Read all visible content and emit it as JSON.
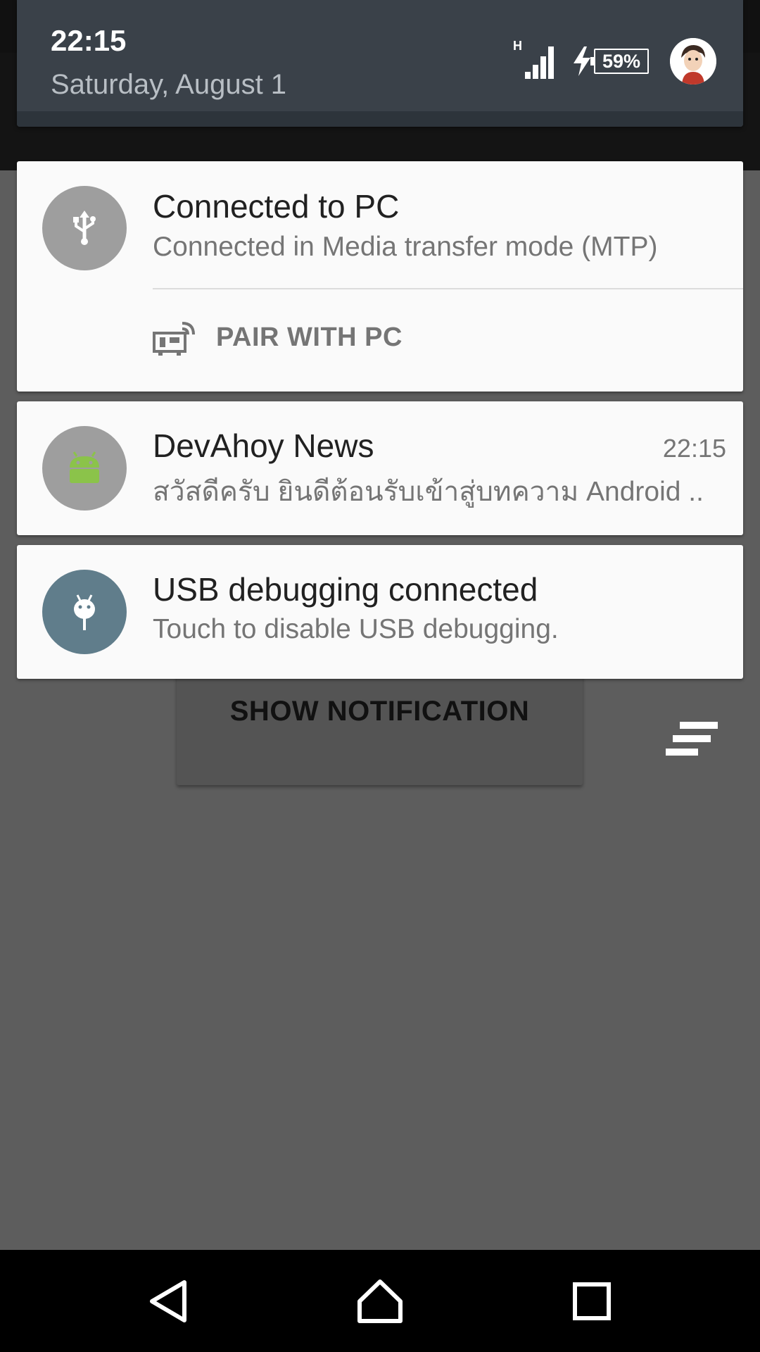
{
  "status_bar": {
    "time": "22:15",
    "date": "Saturday, August 1",
    "network_type": "H",
    "battery_percent": "59%",
    "icons": [
      "signal-icon",
      "charging-icon",
      "battery-icon",
      "user-avatar"
    ]
  },
  "notifications": [
    {
      "icon": "usb-icon",
      "icon_bg": "#9e9e9e",
      "title": "Connected to PC",
      "text": "Connected in Media transfer mode (MTP)",
      "action": {
        "icon": "pair-with-pc-icon",
        "label": "PAIR WITH PC"
      }
    },
    {
      "icon": "android-icon",
      "icon_bg": "#9e9e9e",
      "title": "DevAhoy News",
      "time": "22:15",
      "text": "สวัสดีครับ ยินดีต้อนรับเข้าสู่บทความ Android .."
    },
    {
      "icon": "bug-icon",
      "icon_bg": "#607d8b",
      "title": "USB debugging connected",
      "text": "Touch to disable USB debugging."
    }
  ],
  "app": {
    "show_notification_label": "SHOW NOTIFICATION",
    "dismiss_all_icon": "clear-all-icon"
  },
  "nav_bar": {
    "icons": [
      "back-icon",
      "home-icon",
      "recents-icon"
    ]
  },
  "colors": {
    "shade_header": "#3a4149",
    "card_bg": "#fafafa",
    "usb_debug_accent": "#607d8b",
    "android_green": "#8bc34a"
  }
}
